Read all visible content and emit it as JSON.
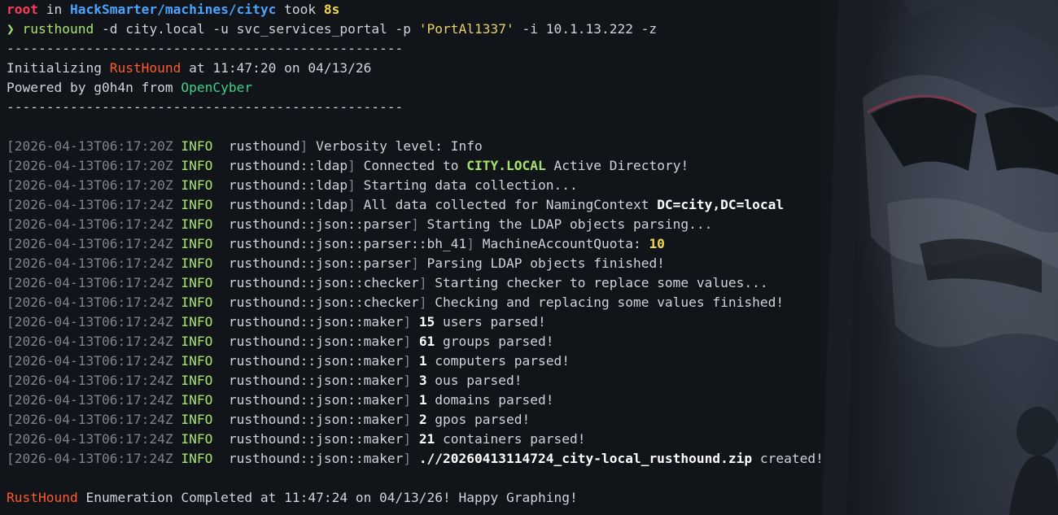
{
  "prompt": {
    "user": "root",
    "in": " in ",
    "path": "HackSmarter/machines/cityc",
    "took": " took ",
    "duration": "8s",
    "arrow": "❯",
    "cmd": "rusthound",
    "args1": " -d city.local -u svc_services_portal -p ",
    "password": "'PortAl1337'",
    "args2": " -i 10.1.13.222 -z"
  },
  "banner": {
    "separator": "--------------------------------------------------",
    "init_prefix": "Initializing ",
    "tool": "RustHound",
    "init_suffix": " at 11:47:20 on 04/13/26",
    "powered_prefix": "Powered by g0h4n from ",
    "org": "OpenCyber"
  },
  "logs": [
    {
      "ts": "[2026-04-13T06:17:20Z",
      "level": "INFO",
      "module": "rusthound",
      "msg_pre": " Verbosity level: Info",
      "highlight": "",
      "msg_post": ""
    },
    {
      "ts": "[2026-04-13T06:17:20Z",
      "level": "INFO",
      "module": "rusthound::ldap",
      "msg_pre": " Connected to ",
      "highlight": "CITY.LOCAL",
      "msg_post": " Active Directory!"
    },
    {
      "ts": "[2026-04-13T06:17:20Z",
      "level": "INFO",
      "module": "rusthound::ldap",
      "msg_pre": " Starting data collection...",
      "highlight": "",
      "msg_post": ""
    },
    {
      "ts": "[2026-04-13T06:17:24Z",
      "level": "INFO",
      "module": "rusthound::ldap",
      "msg_pre": " All data collected for NamingContext ",
      "bold": "DC=city,DC=local",
      "msg_post": ""
    },
    {
      "ts": "[2026-04-13T06:17:24Z",
      "level": "INFO",
      "module": "rusthound::json::parser",
      "msg_pre": " Starting the LDAP objects parsing...",
      "highlight": "",
      "msg_post": ""
    },
    {
      "ts": "[2026-04-13T06:17:24Z",
      "level": "INFO",
      "module": "rusthound::json::parser::bh_41",
      "msg_pre": " MachineAccountQuota: ",
      "yellow": "10",
      "msg_post": ""
    },
    {
      "ts": "[2026-04-13T06:17:24Z",
      "level": "INFO",
      "module": "rusthound::json::parser",
      "msg_pre": " Parsing LDAP objects finished!",
      "highlight": "",
      "msg_post": ""
    },
    {
      "ts": "[2026-04-13T06:17:24Z",
      "level": "INFO",
      "module": "rusthound::json::checker",
      "msg_pre": " Starting checker to replace some values...",
      "highlight": "",
      "msg_post": ""
    },
    {
      "ts": "[2026-04-13T06:17:24Z",
      "level": "INFO",
      "module": "rusthound::json::checker",
      "msg_pre": " Checking and replacing some values finished!",
      "highlight": "",
      "msg_post": ""
    },
    {
      "ts": "[2026-04-13T06:17:24Z",
      "level": "INFO",
      "module": "rusthound::json::maker",
      "msg_pre": " ",
      "bold": "15",
      "msg_post": " users parsed!"
    },
    {
      "ts": "[2026-04-13T06:17:24Z",
      "level": "INFO",
      "module": "rusthound::json::maker",
      "msg_pre": " ",
      "bold": "61",
      "msg_post": " groups parsed!"
    },
    {
      "ts": "[2026-04-13T06:17:24Z",
      "level": "INFO",
      "module": "rusthound::json::maker",
      "msg_pre": " ",
      "bold": "1",
      "msg_post": " computers parsed!"
    },
    {
      "ts": "[2026-04-13T06:17:24Z",
      "level": "INFO",
      "module": "rusthound::json::maker",
      "msg_pre": " ",
      "bold": "3",
      "msg_post": " ous parsed!"
    },
    {
      "ts": "[2026-04-13T06:17:24Z",
      "level": "INFO",
      "module": "rusthound::json::maker",
      "msg_pre": " ",
      "bold": "1",
      "msg_post": " domains parsed!"
    },
    {
      "ts": "[2026-04-13T06:17:24Z",
      "level": "INFO",
      "module": "rusthound::json::maker",
      "msg_pre": " ",
      "bold": "2",
      "msg_post": " gpos parsed!"
    },
    {
      "ts": "[2026-04-13T06:17:24Z",
      "level": "INFO",
      "module": "rusthound::json::maker",
      "msg_pre": " ",
      "bold": "21",
      "msg_post": " containers parsed!"
    },
    {
      "ts": "[2026-04-13T06:17:24Z",
      "level": "INFO",
      "module": "rusthound::json::maker",
      "msg_pre": " ",
      "bold": ".//20260413114724_city-local_rusthound.zip",
      "msg_post": " created!"
    }
  ],
  "footer": {
    "tool": "RustHound",
    "text": " Enumeration Completed at 11:47:24 on 04/13/26! Happy Graphing!"
  },
  "colors": {
    "background": "#111418",
    "user": "#ff3b5c",
    "path": "#4aa3ff",
    "duration": "#f2d84b",
    "info": "#a6e36b",
    "tool": "#ff5a2b",
    "org": "#3ad38a"
  }
}
